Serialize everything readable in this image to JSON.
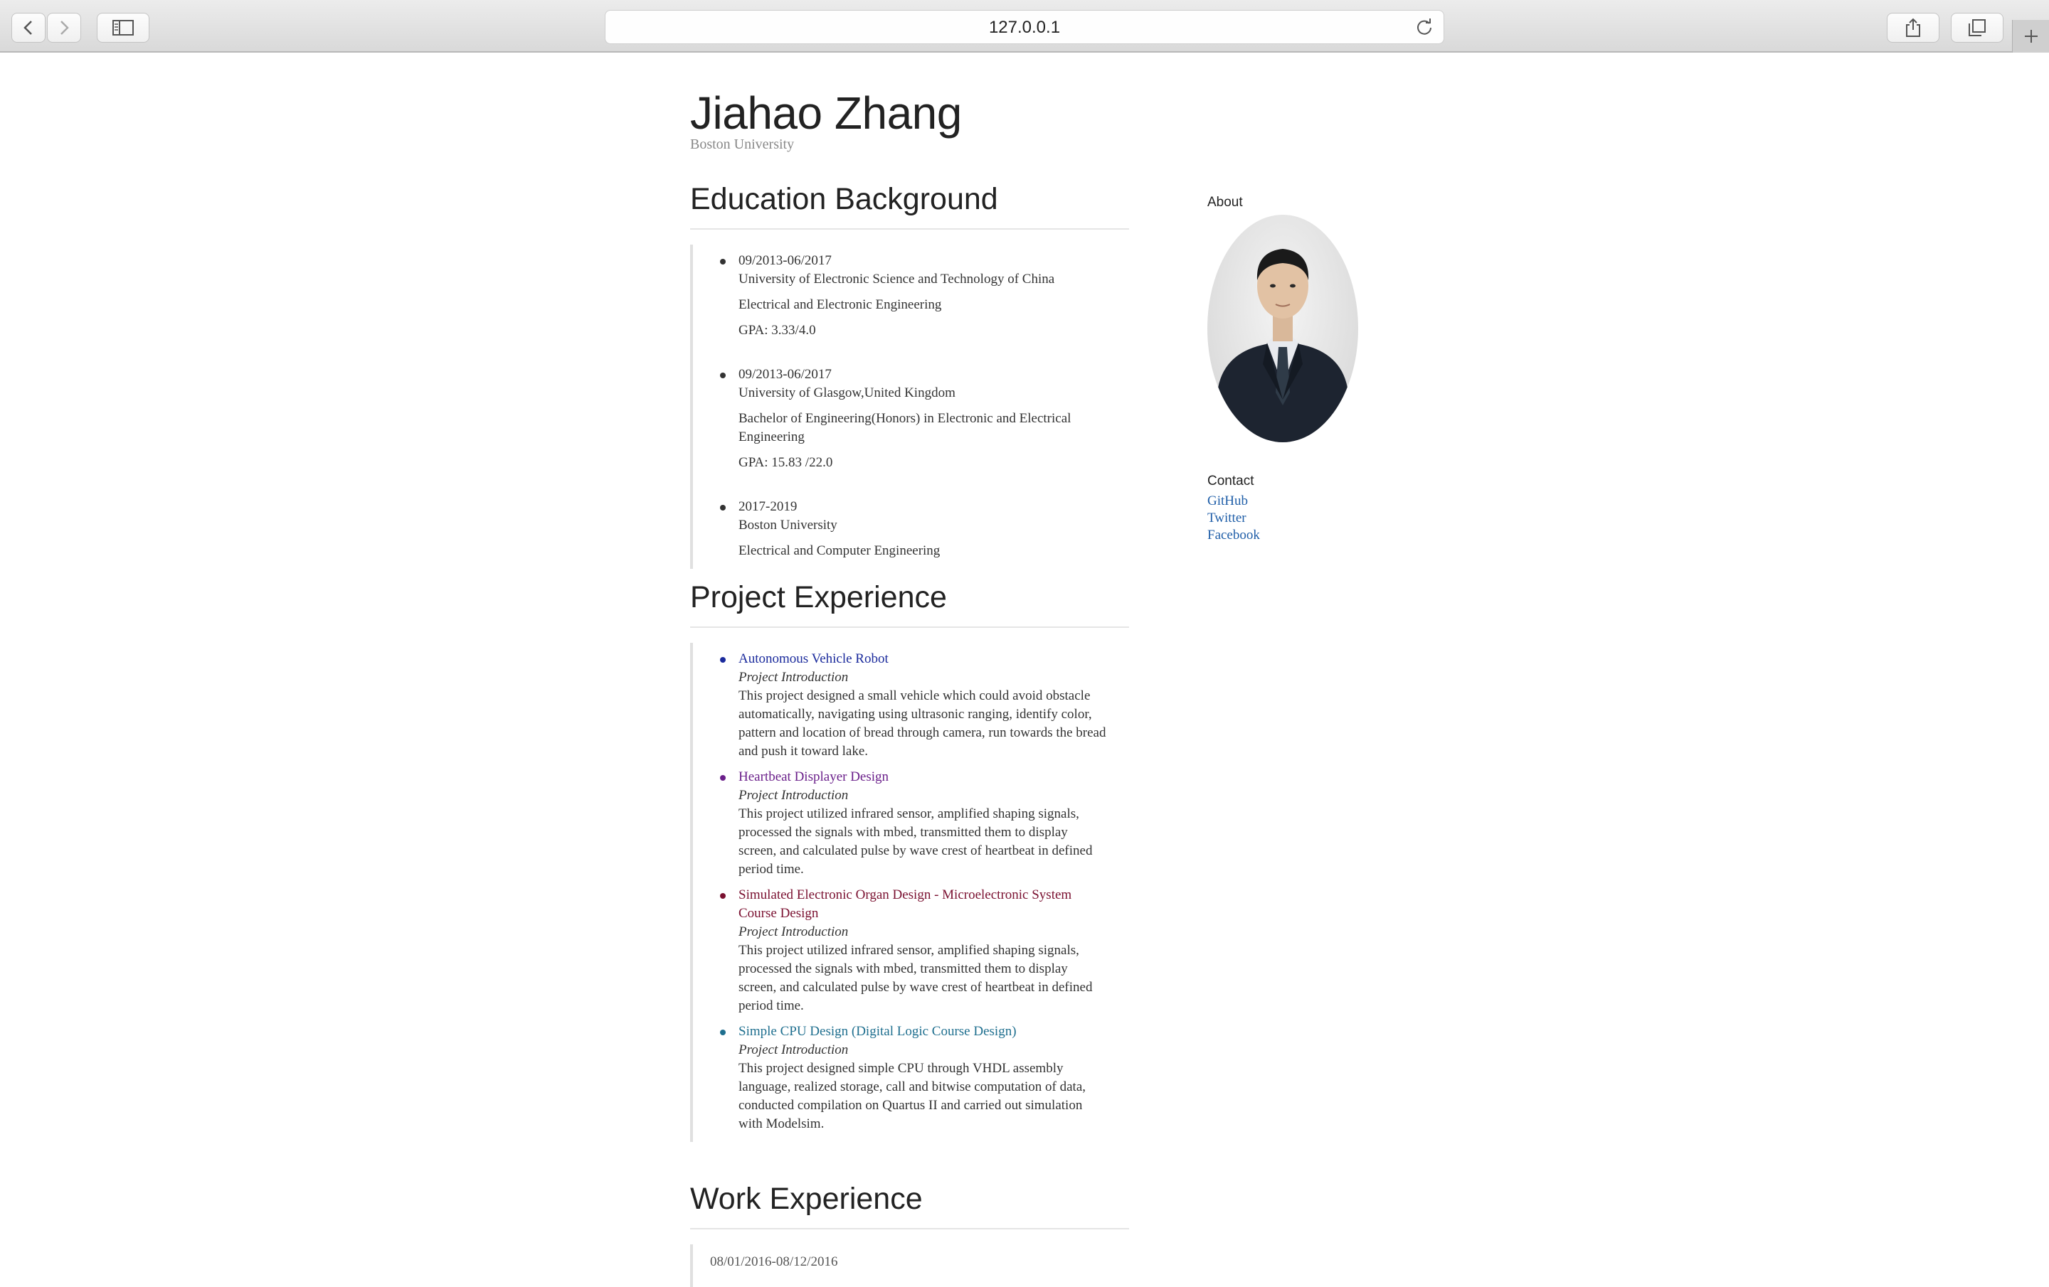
{
  "browser": {
    "url": "127.0.0.1"
  },
  "header": {
    "name": "Jiahao Zhang",
    "affiliation": "Boston University"
  },
  "education": {
    "title": "Education Background",
    "items": [
      {
        "dates": "09/2013-06/2017",
        "school": "University of Electronic Science and Technology of China",
        "degree": "Electrical and Electronic Engineering",
        "gpa": "GPA: 3.33/4.0"
      },
      {
        "dates": "09/2013-06/2017",
        "school": "University of Glasgow,United Kingdom",
        "degree": "Bachelor of Engineering(Honors) in Electronic and Electrical Engineering",
        "gpa": "GPA: 15.83 /22.0"
      },
      {
        "dates": "2017-2019",
        "school": "Boston University",
        "degree": "Electrical and Computer Engineering",
        "gpa": ""
      }
    ]
  },
  "projects": {
    "title": "Project Experience",
    "items": [
      {
        "name": "Autonomous Vehicle Robot",
        "color": "#1a2a9c",
        "intro_label": "Project Introduction",
        "description": "This project designed a small vehicle which could avoid obstacle automatically, navigating using ultrasonic ranging, identify color, pattern and location of bread through camera, run towards the bread and push it toward lake."
      },
      {
        "name": "Heartbeat Displayer Design",
        "color": "#6a1f8a",
        "intro_label": "Project Introduction",
        "description": "This project utilized infrared sensor, amplified shaping signals, processed the signals with mbed, transmitted them to display screen, and calculated pulse by wave crest of heartbeat in defined period time."
      },
      {
        "name": "Simulated Electronic Organ Design - Microelectronic System Course Design",
        "color": "#7a1030",
        "intro_label": "Project Introduction",
        "description": "This project utilized infrared sensor, amplified shaping signals, processed the signals with mbed, transmitted them to display screen, and calculated pulse by wave crest of heartbeat in defined period time."
      },
      {
        "name": "Simple CPU Design (Digital Logic Course Design)",
        "color": "#1f6f8f",
        "intro_label": "Project Introduction",
        "description": "This project designed simple CPU through VHDL assembly language, realized storage, call and bitwise computation of data, conducted compilation on Quartus II and carried out simulation with Modelsim."
      }
    ]
  },
  "work": {
    "title": "Work Experience",
    "first_date": "08/01/2016-08/12/2016"
  },
  "sidebar": {
    "about_label": "About",
    "contact_label": "Contact",
    "links": [
      "GitHub",
      "Twitter",
      "Facebook"
    ],
    "link_color": "#1f5ea8"
  }
}
